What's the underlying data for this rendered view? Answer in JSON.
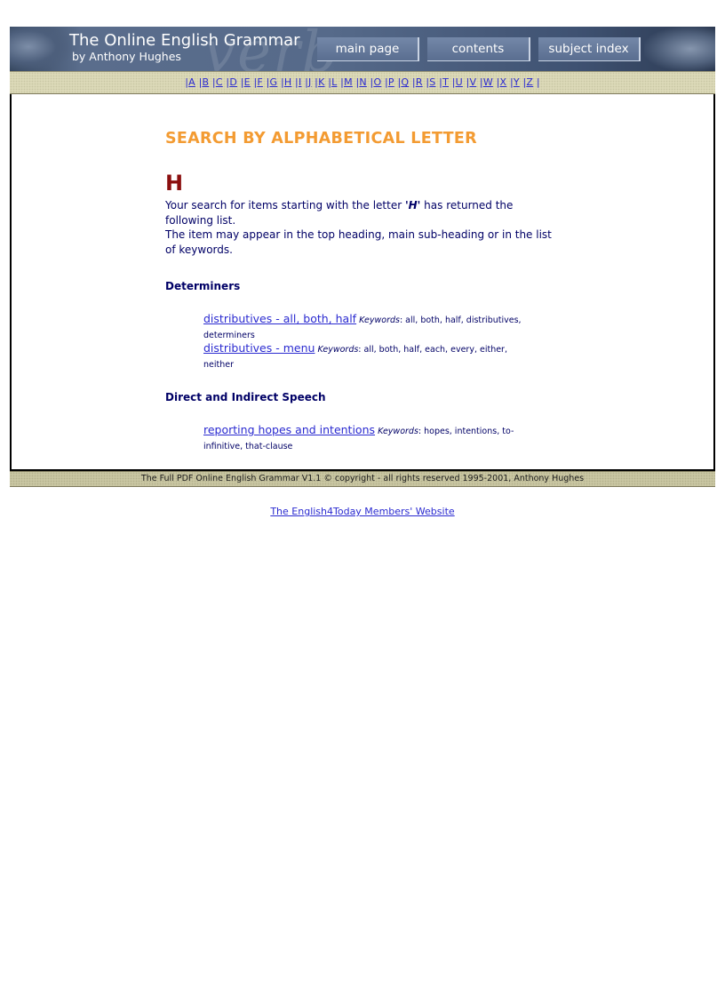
{
  "banner": {
    "title": "The Online English Grammar",
    "subtitle": "by Anthony Hughes",
    "nav": {
      "main_page": "main page",
      "contents": "contents",
      "subject_index": "subject index"
    }
  },
  "alphabet": [
    "A",
    "B",
    "C",
    "D",
    "E",
    "F",
    "G",
    "H",
    "I",
    "J",
    "K",
    "L",
    "M",
    "N",
    "O",
    "P",
    "Q",
    "R",
    "S",
    "T",
    "U",
    "V",
    "W",
    "X",
    "Y",
    "Z"
  ],
  "main": {
    "heading": "SEARCH BY ALPHABETICAL LETTER",
    "letter": "H",
    "intro_before": "Your search for items starting with the letter ",
    "intro_letter": "'H'",
    "intro_after": " has returned the following list.",
    "intro_line2": "The item may appear in the top heading, main sub-heading or in the list of keywords.",
    "keywords_label": "Keywords",
    "sections": [
      {
        "title": "Determiners",
        "entries": [
          {
            "link": "distributives - all, both, half",
            "keywords": ": all, both, half, distributives, determiners"
          },
          {
            "link": "distributives - menu",
            "keywords": ": all, both, half, each, every, either, neither"
          }
        ]
      },
      {
        "title": "Direct and Indirect Speech",
        "entries": [
          {
            "link": "reporting hopes and intentions",
            "keywords": ": hopes, intentions, to-infinitive, that-clause"
          }
        ]
      }
    ]
  },
  "footer": {
    "text": "The Full PDF Online English Grammar V1.1 © copyright - all rights reserved 1995-2001, Anthony Hughes"
  },
  "bottom_link": "The English4Today Members' Website"
}
